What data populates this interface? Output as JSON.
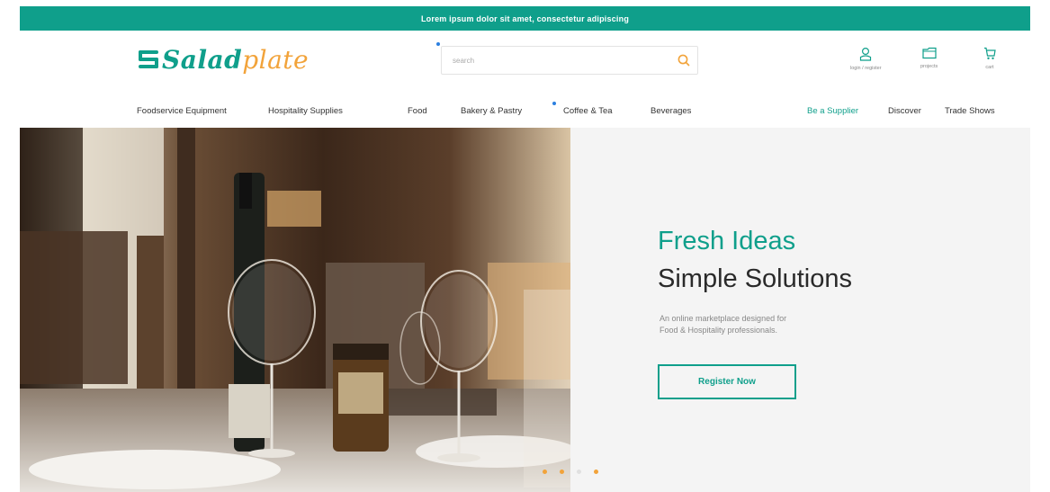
{
  "announcement": "Lorem ipsum dolor sit amet, consectetur adipiscing",
  "brand": {
    "salad": "Salad",
    "plate": "plate",
    "primary_color": "#0f9f8b",
    "secondary_color": "#f2a33a"
  },
  "search": {
    "placeholder": "search",
    "icon": "search-icon"
  },
  "user_actions": [
    {
      "label": "login / register",
      "icon": "user-icon"
    },
    {
      "label": "projects",
      "icon": "folder-icon"
    },
    {
      "label": "cart",
      "icon": "cart-icon"
    }
  ],
  "nav": {
    "categories": [
      "Foodservice Equipment",
      "Hospitality Supplies",
      "Food",
      "Bakery & Pastry",
      "Coffee & Tea",
      "Beverages"
    ],
    "secondary": [
      "Be a Supplier",
      "Discover",
      "Trade Shows"
    ]
  },
  "hero": {
    "title_line1": "Fresh Ideas",
    "title_line2": "Simple Solutions",
    "subtitle_line1": "An online marketplace designed for",
    "subtitle_line2": "Food & Hospitality professionals.",
    "cta_label": "Register Now",
    "slides_total": 4,
    "active_slide": 1,
    "dot_colors": [
      "#f2a33a",
      "#f2a33a",
      "#e0e0e0",
      "#f2a33a"
    ]
  }
}
